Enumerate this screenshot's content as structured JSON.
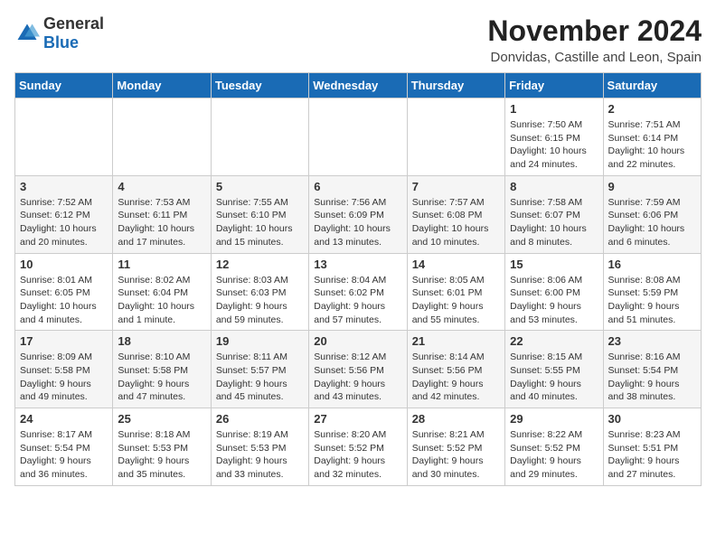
{
  "logo": {
    "general": "General",
    "blue": "Blue"
  },
  "header": {
    "title": "November 2024",
    "subtitle": "Donvidas, Castille and Leon, Spain"
  },
  "weekdays": [
    "Sunday",
    "Monday",
    "Tuesday",
    "Wednesday",
    "Thursday",
    "Friday",
    "Saturday"
  ],
  "weeks": [
    [
      {
        "day": "",
        "info": ""
      },
      {
        "day": "",
        "info": ""
      },
      {
        "day": "",
        "info": ""
      },
      {
        "day": "",
        "info": ""
      },
      {
        "day": "",
        "info": ""
      },
      {
        "day": "1",
        "info": "Sunrise: 7:50 AM\nSunset: 6:15 PM\nDaylight: 10 hours and 24 minutes."
      },
      {
        "day": "2",
        "info": "Sunrise: 7:51 AM\nSunset: 6:14 PM\nDaylight: 10 hours and 22 minutes."
      }
    ],
    [
      {
        "day": "3",
        "info": "Sunrise: 7:52 AM\nSunset: 6:12 PM\nDaylight: 10 hours and 20 minutes."
      },
      {
        "day": "4",
        "info": "Sunrise: 7:53 AM\nSunset: 6:11 PM\nDaylight: 10 hours and 17 minutes."
      },
      {
        "day": "5",
        "info": "Sunrise: 7:55 AM\nSunset: 6:10 PM\nDaylight: 10 hours and 15 minutes."
      },
      {
        "day": "6",
        "info": "Sunrise: 7:56 AM\nSunset: 6:09 PM\nDaylight: 10 hours and 13 minutes."
      },
      {
        "day": "7",
        "info": "Sunrise: 7:57 AM\nSunset: 6:08 PM\nDaylight: 10 hours and 10 minutes."
      },
      {
        "day": "8",
        "info": "Sunrise: 7:58 AM\nSunset: 6:07 PM\nDaylight: 10 hours and 8 minutes."
      },
      {
        "day": "9",
        "info": "Sunrise: 7:59 AM\nSunset: 6:06 PM\nDaylight: 10 hours and 6 minutes."
      }
    ],
    [
      {
        "day": "10",
        "info": "Sunrise: 8:01 AM\nSunset: 6:05 PM\nDaylight: 10 hours and 4 minutes."
      },
      {
        "day": "11",
        "info": "Sunrise: 8:02 AM\nSunset: 6:04 PM\nDaylight: 10 hours and 1 minute."
      },
      {
        "day": "12",
        "info": "Sunrise: 8:03 AM\nSunset: 6:03 PM\nDaylight: 9 hours and 59 minutes."
      },
      {
        "day": "13",
        "info": "Sunrise: 8:04 AM\nSunset: 6:02 PM\nDaylight: 9 hours and 57 minutes."
      },
      {
        "day": "14",
        "info": "Sunrise: 8:05 AM\nSunset: 6:01 PM\nDaylight: 9 hours and 55 minutes."
      },
      {
        "day": "15",
        "info": "Sunrise: 8:06 AM\nSunset: 6:00 PM\nDaylight: 9 hours and 53 minutes."
      },
      {
        "day": "16",
        "info": "Sunrise: 8:08 AM\nSunset: 5:59 PM\nDaylight: 9 hours and 51 minutes."
      }
    ],
    [
      {
        "day": "17",
        "info": "Sunrise: 8:09 AM\nSunset: 5:58 PM\nDaylight: 9 hours and 49 minutes."
      },
      {
        "day": "18",
        "info": "Sunrise: 8:10 AM\nSunset: 5:58 PM\nDaylight: 9 hours and 47 minutes."
      },
      {
        "day": "19",
        "info": "Sunrise: 8:11 AM\nSunset: 5:57 PM\nDaylight: 9 hours and 45 minutes."
      },
      {
        "day": "20",
        "info": "Sunrise: 8:12 AM\nSunset: 5:56 PM\nDaylight: 9 hours and 43 minutes."
      },
      {
        "day": "21",
        "info": "Sunrise: 8:14 AM\nSunset: 5:56 PM\nDaylight: 9 hours and 42 minutes."
      },
      {
        "day": "22",
        "info": "Sunrise: 8:15 AM\nSunset: 5:55 PM\nDaylight: 9 hours and 40 minutes."
      },
      {
        "day": "23",
        "info": "Sunrise: 8:16 AM\nSunset: 5:54 PM\nDaylight: 9 hours and 38 minutes."
      }
    ],
    [
      {
        "day": "24",
        "info": "Sunrise: 8:17 AM\nSunset: 5:54 PM\nDaylight: 9 hours and 36 minutes."
      },
      {
        "day": "25",
        "info": "Sunrise: 8:18 AM\nSunset: 5:53 PM\nDaylight: 9 hours and 35 minutes."
      },
      {
        "day": "26",
        "info": "Sunrise: 8:19 AM\nSunset: 5:53 PM\nDaylight: 9 hours and 33 minutes."
      },
      {
        "day": "27",
        "info": "Sunrise: 8:20 AM\nSunset: 5:52 PM\nDaylight: 9 hours and 32 minutes."
      },
      {
        "day": "28",
        "info": "Sunrise: 8:21 AM\nSunset: 5:52 PM\nDaylight: 9 hours and 30 minutes."
      },
      {
        "day": "29",
        "info": "Sunrise: 8:22 AM\nSunset: 5:52 PM\nDaylight: 9 hours and 29 minutes."
      },
      {
        "day": "30",
        "info": "Sunrise: 8:23 AM\nSunset: 5:51 PM\nDaylight: 9 hours and 27 minutes."
      }
    ]
  ]
}
